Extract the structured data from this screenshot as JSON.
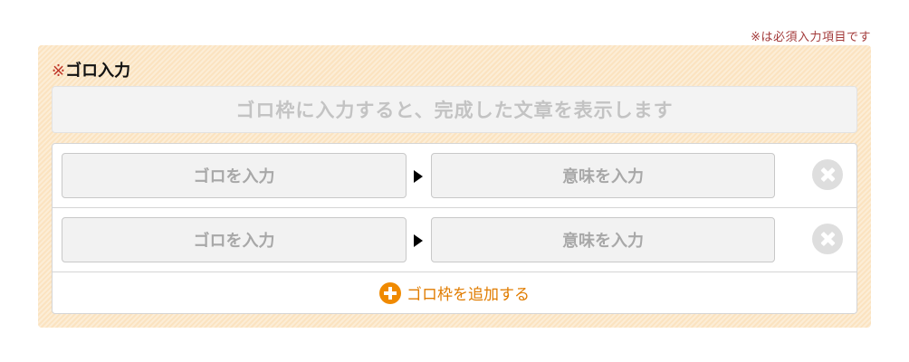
{
  "required_note": "※は必須入力項目です",
  "panel": {
    "title_mark": "※",
    "title": "ゴロ入力",
    "preview_text": "ゴロ枠に入力すると、完成した文章を表示します"
  },
  "rows": [
    {
      "goro_placeholder": "ゴロを入力",
      "meaning_placeholder": "意味を入力"
    },
    {
      "goro_placeholder": "ゴロを入力",
      "meaning_placeholder": "意味を入力"
    }
  ],
  "add_button_label": "ゴロ枠を追加する",
  "icons": {
    "arrow": "triangle-right-icon",
    "delete": "close-circle-icon",
    "add": "plus-circle-icon"
  },
  "colors": {
    "panel_bg": "#fbe3c0",
    "accent": "#f08a00",
    "required": "#a33a3a"
  }
}
